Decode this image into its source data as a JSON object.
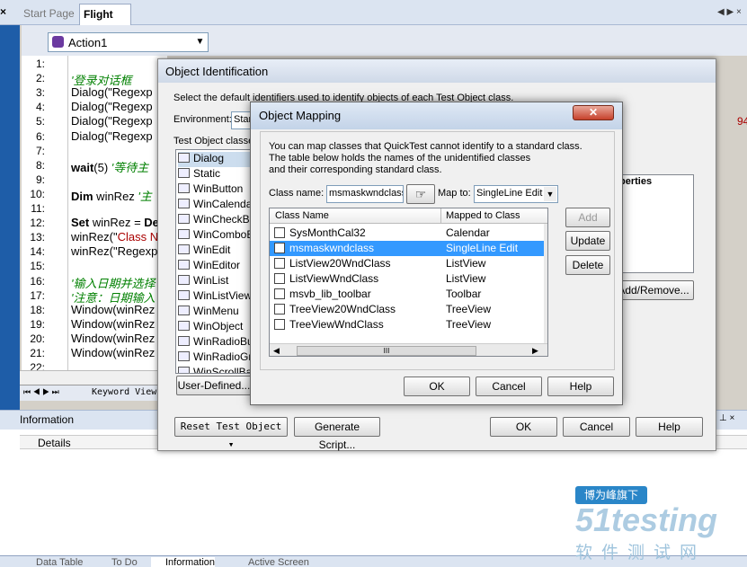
{
  "tabs": {
    "start_page": "Start Page",
    "flight": "Flight",
    "close": "×"
  },
  "action": {
    "selected": "Action1"
  },
  "editor": {
    "line_numbers": [
      "1:",
      "2:",
      "3:",
      "4:",
      "5:",
      "6:",
      "7:",
      "8:",
      "9:",
      "10:",
      "11:",
      "12:",
      "13:",
      "14:",
      "15:",
      "16:",
      "17:",
      "18:",
      "19:",
      "20:",
      "21:",
      "22:"
    ],
    "lines": [
      {
        "n": 2,
        "text": "'登录对话框",
        "style": "green"
      },
      {
        "n": 3,
        "text": "Dialog(\"Regexp",
        "style": "plain"
      },
      {
        "n": 4,
        "text": "Dialog(\"Regexp",
        "style": "plain"
      },
      {
        "n": 5,
        "text": "Dialog(\"Regexp",
        "style": "plain"
      },
      {
        "n": 6,
        "text": "Dialog(\"Regexp",
        "style": "plain"
      },
      {
        "n": 8,
        "kw": "wait",
        "text": "(5)",
        "comment": " '等待主",
        "style": "kwline"
      },
      {
        "n": 10,
        "kw": "Dim",
        "text": " winRez",
        "comment": " '主",
        "style": "kwline"
      },
      {
        "n": 12,
        "kw": "Set",
        "text": " winRez = ",
        "kw2": "De",
        "style": "set"
      },
      {
        "n": 13,
        "text": "winRez(\"",
        "red": "Class N",
        "style": "redline"
      },
      {
        "n": 14,
        "text": "winRez(\"Regexp",
        "style": "plain"
      },
      {
        "n": 16,
        "text": "'输入日期并选择",
        "style": "green"
      },
      {
        "n": 17,
        "text": "'注意：日期输入",
        "style": "green"
      },
      {
        "n": 18,
        "text": "Window(winRez",
        "style": "plain"
      },
      {
        "n": 19,
        "text": "Window(winRez",
        "style": "plain"
      },
      {
        "n": 20,
        "text": "Window(winRez",
        "style": "plain"
      },
      {
        "n": 21,
        "text": "Window(winRez",
        "style": "plain"
      }
    ]
  },
  "keyword_view": "Keyword View",
  "info": {
    "title": "Information",
    "details": "Details"
  },
  "bottom_tabs": [
    "Data Table",
    "To Do",
    "Information",
    "Active Screen"
  ],
  "oi_dialog": {
    "title": "Object Identification",
    "desc": "Select the default identifiers used to identify objects of each Test Object class.",
    "environment_label": "Environment:",
    "environment_value": "Star",
    "classes_label": "Test Object classes",
    "classes": [
      "Dialog",
      "Static",
      "WinButton",
      "WinCalendar",
      "WinCheckBox",
      "WinComboBox",
      "WinEdit",
      "WinEditor",
      "WinList",
      "WinListView",
      "WinMenu",
      "WinObject",
      "WinRadioButton",
      "WinRadioGroup",
      "WinScrollBar"
    ],
    "user_defined": "User-Defined...",
    "properties_head": "perties",
    "add_remove": "Add/Remove...",
    "reset": "Reset Test Object",
    "generate": "Generate Script...",
    "ok": "OK",
    "cancel": "Cancel",
    "help": "Help",
    "right_edge": "94"
  },
  "om_dialog": {
    "title": "Object Mapping",
    "desc1": "You can map classes that QuickTest cannot identify to a standard class.",
    "desc2": "The table below holds the names of the unidentified classes",
    "desc3": "and their corresponding standard class.",
    "class_name_label": "Class name:",
    "class_name_value": "msmaskwndclass",
    "map_to_label": "Map to:",
    "map_to_value": "SingleLine Edit",
    "col1": "Class Name",
    "col2": "Mapped to Class",
    "rows": [
      {
        "cls": "SysMonthCal32",
        "map": "Calendar"
      },
      {
        "cls": "msmaskwndclass",
        "map": "SingleLine Edit"
      },
      {
        "cls": "ListView20WndClass",
        "map": "ListView"
      },
      {
        "cls": "ListViewWndClass",
        "map": "ListView"
      },
      {
        "cls": "msvb_lib_toolbar",
        "map": "Toolbar"
      },
      {
        "cls": "TreeView20WndClass",
        "map": "TreeView"
      },
      {
        "cls": "TreeViewWndClass",
        "map": "TreeView"
      }
    ],
    "add": "Add",
    "update": "Update",
    "delete": "Delete",
    "ok": "OK",
    "cancel": "Cancel",
    "help": "Help",
    "hscroll": "III"
  },
  "watermark": {
    "badge": "博为峰旗下",
    "brand": "51testing",
    "sub": "软件测试网"
  }
}
